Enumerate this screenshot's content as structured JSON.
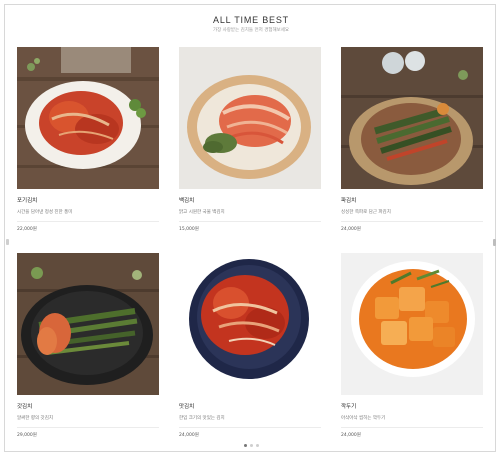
{
  "section": {
    "title": "ALL TIME BEST",
    "subtitle": "가장 사랑받는 김치들 먼저 경험해보세요"
  },
  "products": [
    {
      "name": "포기김치",
      "desc": "시간을 담아낸 정성 진한 풍미",
      "price": "22,000원",
      "image": "kimchi-cabbage-white-plate-icon"
    },
    {
      "name": "백김치",
      "desc": "맑고 시원한 국물 백김치",
      "price": "15,000원",
      "image": "white-kimchi-wooden-plate-icon"
    },
    {
      "name": "파김치",
      "desc": "싱싱한 쪽파로 담근 파김치",
      "price": "24,000원",
      "image": "green-onion-kimchi-wooden-plate-icon"
    },
    {
      "name": "갓김치",
      "desc": "알싸한 향의 갓김치",
      "price": "29,000원",
      "image": "mustard-leaf-kimchi-black-plate-icon"
    },
    {
      "name": "맛김치",
      "desc": "한입 크기의 맛있는 김치",
      "price": "24,000원",
      "image": "kimchi-navy-bowl-icon"
    },
    {
      "name": "깍두기",
      "desc": "아삭아삭 씹히는 깍두기",
      "price": "24,000원",
      "image": "radish-kimchi-cubes-icon"
    }
  ],
  "pager": {
    "count": 3,
    "active": 1
  }
}
